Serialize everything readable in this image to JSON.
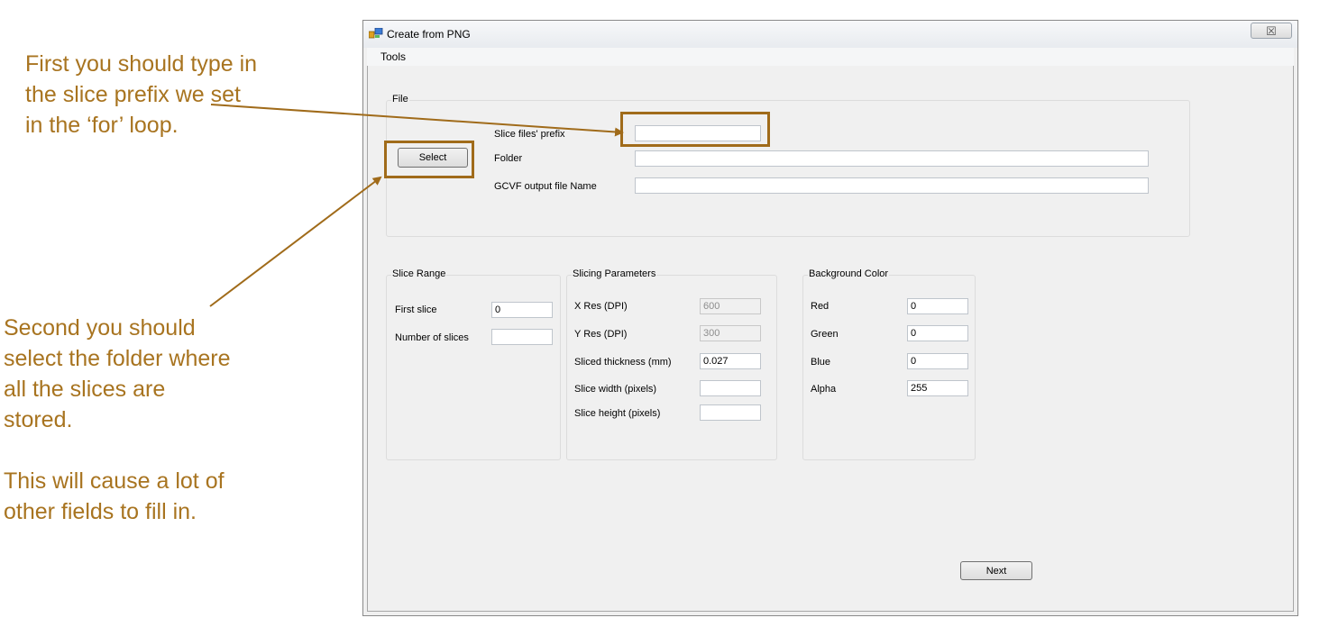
{
  "annotations": {
    "note1": "First you should type in the slice prefix we set in the ‘for’ loop.",
    "note2": "Second you should select the folder where all the slices are stored.",
    "note3": "This will cause a lot of other fields to fill in."
  },
  "window": {
    "title": "Create from PNG",
    "close_symbol": "☒",
    "menu": [
      "Tools"
    ]
  },
  "file_group": {
    "title": "File",
    "select_button": "Select",
    "prefix_label": "Slice files' prefix",
    "prefix_value": "",
    "folder_label": "Folder",
    "folder_value": "",
    "output_label": "GCVF output file Name",
    "output_value": ""
  },
  "slice_range": {
    "title": "Slice Range",
    "first_label": "First slice",
    "first_value": "0",
    "count_label": "Number of slices",
    "count_value": ""
  },
  "slicing_params": {
    "title": "Slicing Parameters",
    "xres_label": "X Res (DPI)",
    "xres_value": "600",
    "yres_label": "Y Res (DPI)",
    "yres_value": "300",
    "thickness_label": "Sliced thickness (mm)",
    "thickness_value": "0.027",
    "width_label": "Slice width (pixels)",
    "width_value": "",
    "height_label": "Slice height (pixels)",
    "height_value": ""
  },
  "background_color": {
    "title": "Background Color",
    "red_label": "Red",
    "red_value": "0",
    "green_label": "Green",
    "green_value": "0",
    "blue_label": "Blue",
    "blue_value": "0",
    "alpha_label": "Alpha",
    "alpha_value": "255"
  },
  "next_button": "Next",
  "colors": {
    "annotation": "#a87420",
    "highlight": "#a06b1a"
  }
}
